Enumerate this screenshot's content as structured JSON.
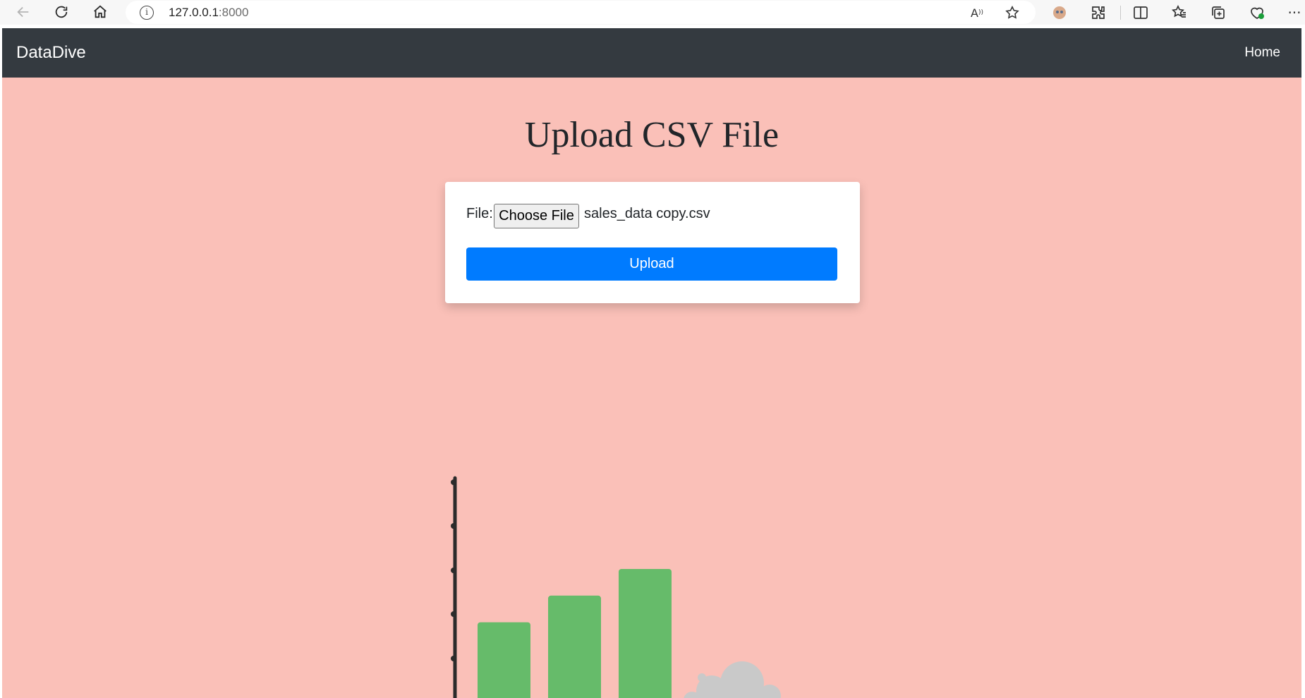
{
  "browser": {
    "url_host": "127.0.0.1",
    "url_port": ":8000"
  },
  "navbar": {
    "brand": "DataDive",
    "home_link": "Home"
  },
  "main": {
    "title": "Upload CSV File",
    "form": {
      "file_label": "File:",
      "choose_file_label": "Choose File",
      "selected_file": "sales_data copy.csv",
      "upload_label": "Upload"
    }
  },
  "illustration": {
    "bar_values": [
      0.36,
      0.48,
      0.6
    ],
    "bar_color": "#66bb6a",
    "cloud_color": "#c9c9c9",
    "axis_color": "#2b2b2b"
  },
  "colors": {
    "page_background": "#fac0b8",
    "navbar_background": "#343a40",
    "primary_button": "#007bff"
  }
}
